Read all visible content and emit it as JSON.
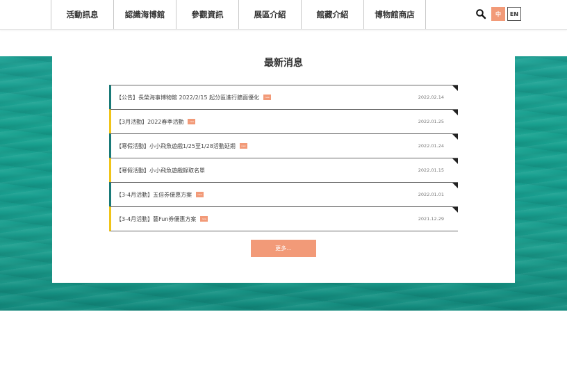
{
  "nav": {
    "items": [
      {
        "label": "活動訊息"
      },
      {
        "label": "認識海博館"
      },
      {
        "label": "參觀資訊"
      },
      {
        "label": "展區介紹"
      },
      {
        "label": "館藏介紹"
      },
      {
        "label": "博物館商店"
      }
    ],
    "lang_zh": "中",
    "lang_en": "EN",
    "search_icon": "search-icon"
  },
  "news": {
    "heading": "最新消息",
    "items": [
      {
        "title": "【公告】長榮海事博物館 2022/2/15 起分區進行牆面優化",
        "badge": "new",
        "date": "2022.02.14",
        "accent": "#1a7a78"
      },
      {
        "title": "【3月活動】2022春季活動",
        "badge": "new",
        "date": "2022.01.25",
        "accent": "#f0c419"
      },
      {
        "title": "【寒假活動】小小飛魚遊戲1/25至1/28活動延期",
        "badge": "new",
        "date": "2022.01.24",
        "accent": "#1a7a78"
      },
      {
        "title": "【寒假活動】小小飛魚遊戲錄取名單",
        "badge": "",
        "date": "2022.01.15",
        "accent": "#f0c419"
      },
      {
        "title": "【3-4月活動】五倍券優惠方案",
        "badge": "new",
        "date": "2022.01.01",
        "accent": "#1a7a78"
      },
      {
        "title": "【3-4月活動】藝Fun券優惠方案",
        "badge": "new",
        "date": "2021.12.29",
        "accent": "#f0c419"
      }
    ],
    "more_label": "更多..."
  },
  "colors": {
    "accent_orange": "#f29a78",
    "teal": "#1a7a78",
    "yellow": "#f0c419",
    "sea": "#17a08e"
  }
}
